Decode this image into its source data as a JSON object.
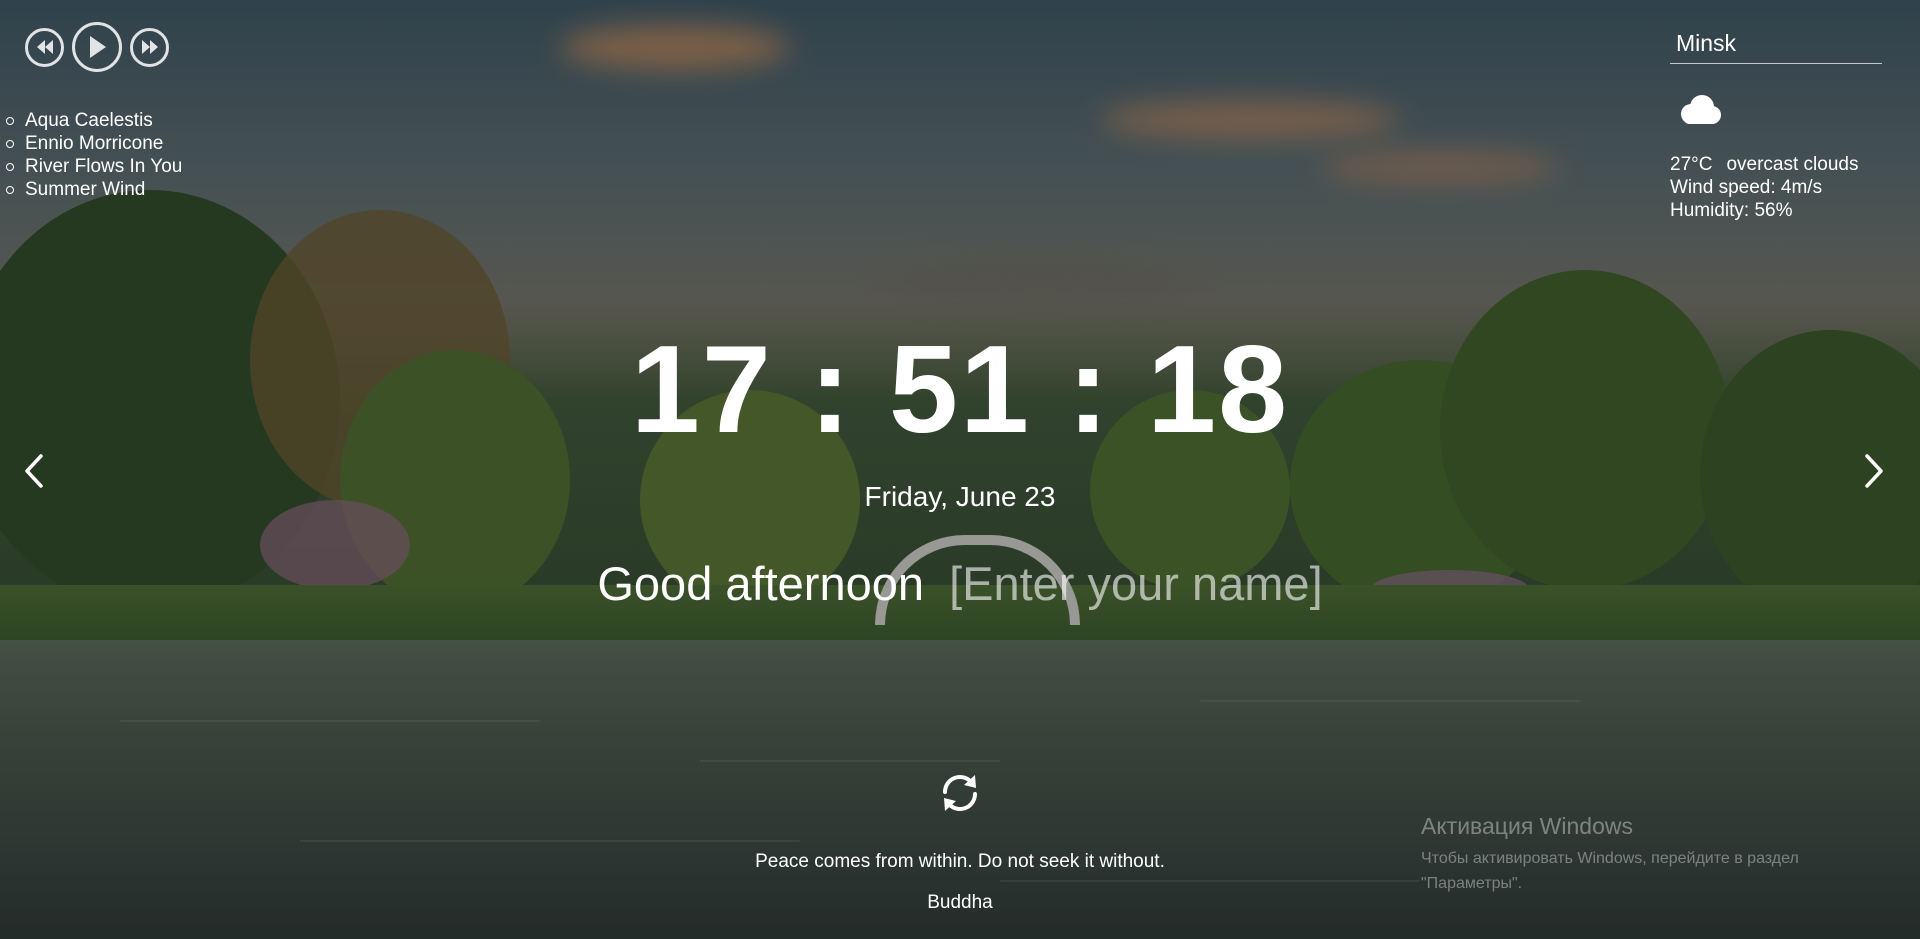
{
  "player": {
    "prev_icon": "rewind-icon",
    "play_icon": "play-icon",
    "next_icon": "fast-forward-icon",
    "playlist": [
      "Aqua Caelestis",
      "Ennio Morricone",
      "River Flows In You",
      "Summer Wind"
    ]
  },
  "weather": {
    "city": "Minsk",
    "icon": "cloud-icon",
    "temperature": "27°C",
    "description": "overcast clouds",
    "wind": "Wind speed: 4m/s",
    "humidity": "Humidity: 56%"
  },
  "clock": {
    "time": "17:51:18"
  },
  "date": "Friday, June 23",
  "greeting": {
    "text": "Good afternoon",
    "name_placeholder": "[Enter your name]"
  },
  "slider": {
    "prev_icon": "chevron-left-icon",
    "next_icon": "chevron-right-icon"
  },
  "quote": {
    "refresh_icon": "refresh-icon",
    "text": "Peace comes from within. Do not seek it without.",
    "author": "Buddha"
  },
  "activation": {
    "title": "Активация Windows",
    "text": "Чтобы активировать Windows, перейдите в раздел \"Параметры\"."
  },
  "colors": {
    "text": "#ffffff",
    "shade": "#0a0f0f"
  }
}
